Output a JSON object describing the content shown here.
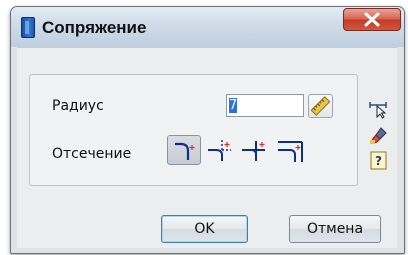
{
  "window": {
    "title": "Сопряжение"
  },
  "form": {
    "radius_label": "Радиус",
    "radius_value": "7",
    "trim_label": "Отсечение",
    "trim_options": [
      {
        "id": "trim-both",
        "selected": true
      },
      {
        "id": "trim-first",
        "selected": false
      },
      {
        "id": "no-trim",
        "selected": false
      },
      {
        "id": "trim-second",
        "selected": false
      }
    ]
  },
  "buttons": {
    "ok": "OK",
    "cancel": "Отмена"
  },
  "colors": {
    "trim_red": "#d0342c",
    "trim_line": "#0f2f86",
    "select_blue": "#2f6fe0"
  }
}
